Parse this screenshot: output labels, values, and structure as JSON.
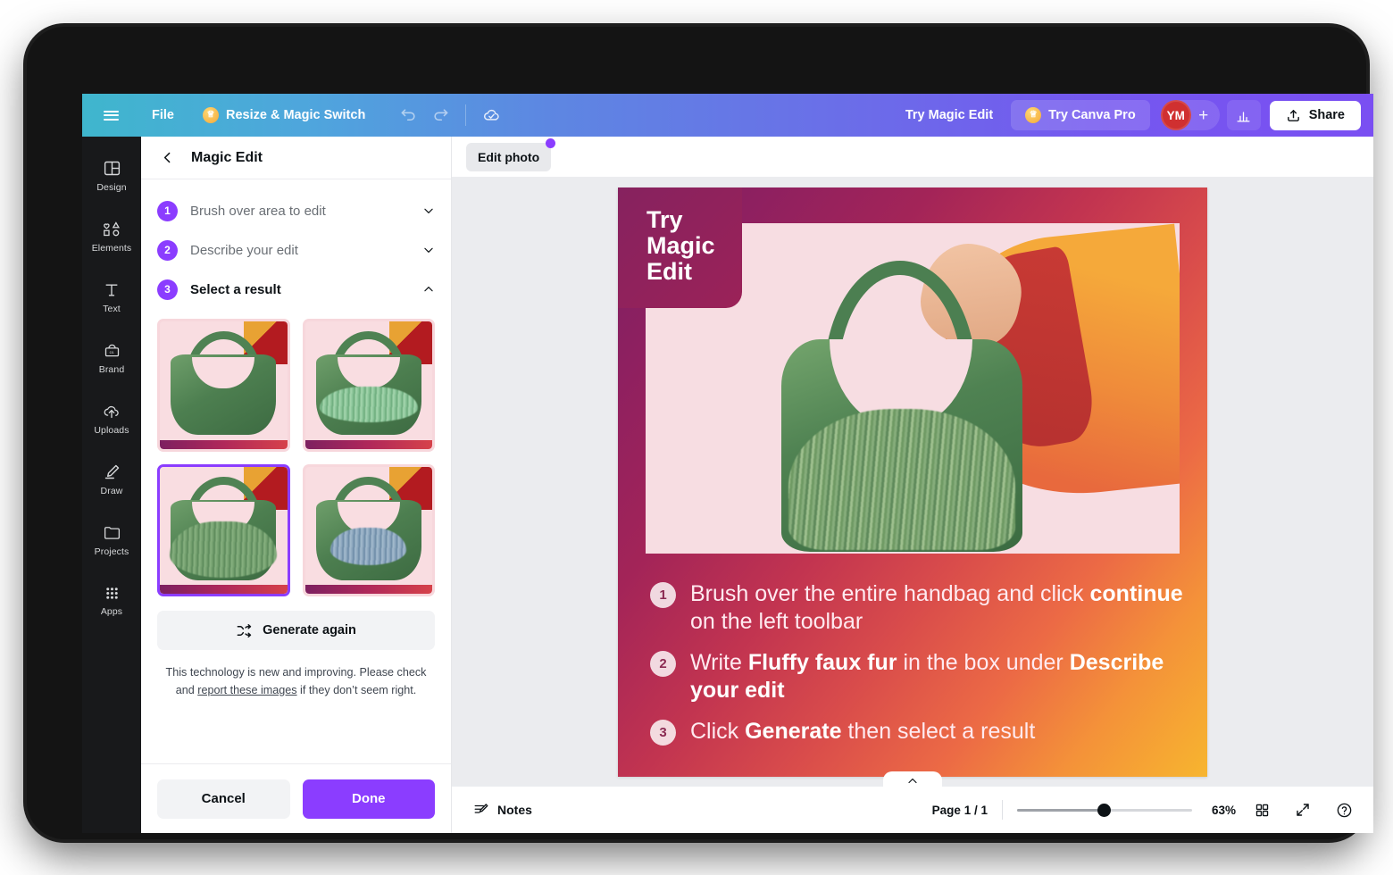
{
  "topbar": {
    "menu_icon": "hamburger-icon",
    "file_label": "File",
    "resize_label": "Resize & Magic Switch",
    "crown_icon": "crown-icon",
    "undo_icon": "undo-icon",
    "redo_icon": "redo-icon",
    "cloud_icon": "cloud-check-icon",
    "try_magic_edit_label": "Try Magic Edit",
    "try_canva_pro_label": "Try Canva Pro",
    "avatar_initials": "YM",
    "avatar_plus": "+",
    "analytics_icon": "analytics-bar-chart-icon",
    "share_label": "Share",
    "share_icon": "share-upload-icon",
    "gradient_from": "#3fb6cd",
    "gradient_to": "#7a4ff2"
  },
  "rail": {
    "items": [
      {
        "label": "Design",
        "icon": "design-layout-icon"
      },
      {
        "label": "Elements",
        "icon": "elements-shapes-icon"
      },
      {
        "label": "Text",
        "icon": "text-t-icon"
      },
      {
        "label": "Brand",
        "icon": "brand-box-icon"
      },
      {
        "label": "Uploads",
        "icon": "uploads-cloud-arrow-icon"
      },
      {
        "label": "Draw",
        "icon": "draw-pen-icon"
      },
      {
        "label": "Projects",
        "icon": "projects-folder-icon"
      },
      {
        "label": "Apps",
        "icon": "apps-grid-icon"
      }
    ]
  },
  "panel": {
    "back_icon": "chevron-left-icon",
    "title": "Magic Edit",
    "steps": [
      {
        "num": "1",
        "label": "Brush over area to edit",
        "expanded": false,
        "chevron": "chevron-down-icon"
      },
      {
        "num": "2",
        "label": "Describe your edit",
        "expanded": false,
        "chevron": "chevron-down-icon"
      },
      {
        "num": "3",
        "label": "Select a result",
        "expanded": true,
        "chevron": "chevron-up-icon"
      }
    ],
    "results": [
      {
        "name": "result-1-plain-green-bag",
        "selected": false,
        "fur": "none",
        "fur_color": ""
      },
      {
        "name": "result-2-mint-fur-bag",
        "selected": false,
        "fur": "mint",
        "fur_color": "#8cc69a"
      },
      {
        "name": "result-3-green-fur-bag",
        "selected": true,
        "fur": "green",
        "fur_color": "#76a271"
      },
      {
        "name": "result-4-blue-fur-bag",
        "selected": false,
        "fur": "blue",
        "fur_color": "#8fa9c0"
      }
    ],
    "generate_again_label": "Generate again",
    "generate_again_icon": "shuffle-icon",
    "disclaimer_prefix": "This technology is new and improving. Please check and ",
    "disclaimer_link": "report these images",
    "disclaimer_suffix": " if they don’t seem right.",
    "cancel_label": "Cancel",
    "done_label": "Done",
    "accent_color": "#8b3dff"
  },
  "canvas": {
    "edit_photo_label": "Edit photo",
    "edit_photo_badge": "purple-dot-indicator",
    "design": {
      "badge_text": "Try\nMagic\nEdit",
      "steps": [
        {
          "num": "1",
          "parts": [
            {
              "t": "Brush over the entire handbag and click ",
              "b": false
            },
            {
              "t": "continue",
              "b": true
            },
            {
              "t": " on the left toolbar",
              "b": false
            }
          ]
        },
        {
          "num": "2",
          "parts": [
            {
              "t": "Write ",
              "b": false
            },
            {
              "t": "Fluffy faux fur",
              "b": true
            },
            {
              "t": " in the box under ",
              "b": false
            },
            {
              "t": "Describe your edit",
              "b": true
            }
          ]
        },
        {
          "num": "3",
          "parts": [
            {
              "t": "Click ",
              "b": false
            },
            {
              "t": "Generate",
              "b": true
            },
            {
              "t": " then select a result",
              "b": false
            }
          ]
        }
      ]
    },
    "collapse_icon": "chevron-up-icon"
  },
  "bottombar": {
    "notes_label": "Notes",
    "notes_icon": "notes-pencil-icon",
    "page_indicator": "Page 1 / 1",
    "zoom_percent": "63%",
    "zoom_value": 63,
    "grid_icon": "grid-view-icon",
    "fullscreen_icon": "expand-fullscreen-icon",
    "help_icon": "help-question-icon"
  }
}
